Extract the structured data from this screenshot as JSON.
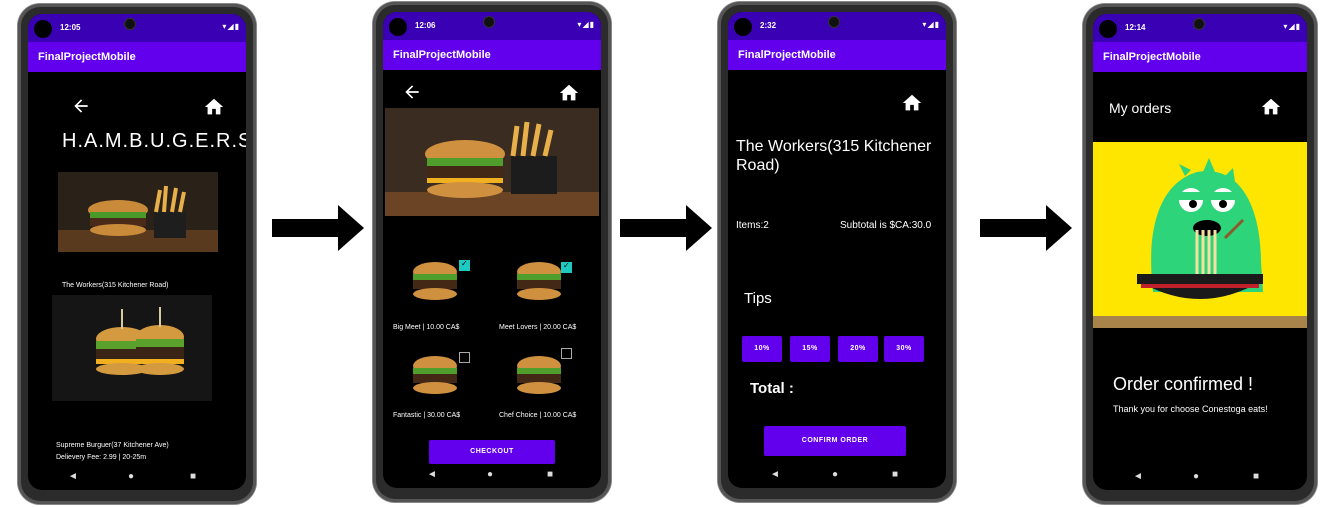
{
  "app_title": "FinalProjectMobile",
  "nav": {
    "back": "◄",
    "home": "●",
    "recents": "■"
  },
  "screen1": {
    "time": "12:05",
    "heading": "H.A.M.B.U.G.E.R.S",
    "restaurant1": "The Workers(315 Kitchener Road)",
    "restaurant2": "Supreme Burguer(37 Kitchener Ave)",
    "restaurant2_info": "Delievery Fee: 2.99 | 20-25m"
  },
  "screen2": {
    "time": "12:06",
    "items": [
      {
        "label": "Big Meet | 10.00 CA$",
        "checked": true
      },
      {
        "label": "Meet Lovers | 20.00 CA$",
        "checked": true
      },
      {
        "label": "Fantastic | 30.00 CA$",
        "checked": false
      },
      {
        "label": "Chef Choice | 10.00 CA$",
        "checked": false
      }
    ],
    "checkout": "CHECKOUT"
  },
  "screen3": {
    "time": "2:32",
    "restaurant_line1": "The Workers(315 Kitchener",
    "restaurant_line2": "Road)",
    "items": "Items:2",
    "subtotal": "Subtotal is $CA:30.0",
    "tips_label": "Tips",
    "tips": [
      "10%",
      "15%",
      "20%",
      "30%"
    ],
    "total": "Total :",
    "confirm": "CONFIRM ORDER"
  },
  "screen4": {
    "time": "12:14",
    "title": "My orders",
    "confirmed": "Order confirmed !",
    "thanks": "Thank you for choose Conestoga eats!"
  },
  "colors": {
    "appbar": "#6200ee",
    "statusbar": "#3a00b4",
    "checkbox": "#1ec9c0",
    "mascot_bg": "#ffe600",
    "mascot": "#2ed47a"
  }
}
